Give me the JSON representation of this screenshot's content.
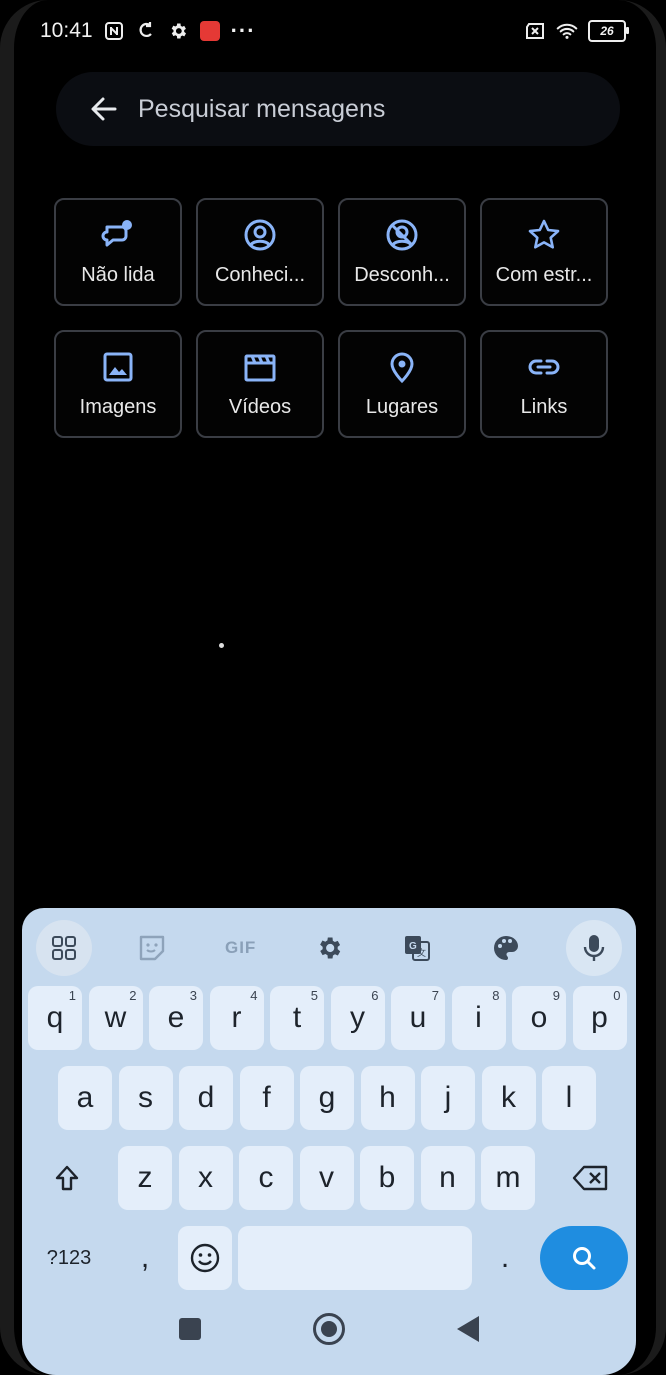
{
  "status_bar": {
    "time": "10:41",
    "more": "···",
    "battery": "26"
  },
  "search": {
    "placeholder": "Pesquisar mensagens"
  },
  "filters": {
    "row1": [
      {
        "label": "Não lida",
        "icon": "unread-chat-icon"
      },
      {
        "label": "Conheci...",
        "icon": "account-circle-icon"
      },
      {
        "label": "Desconh...",
        "icon": "unknown-account-icon"
      },
      {
        "label": "Com estr...",
        "icon": "star-icon"
      }
    ],
    "row2": [
      {
        "label": "Imagens",
        "icon": "image-icon"
      },
      {
        "label": "Vídeos",
        "icon": "video-clapper-icon"
      },
      {
        "label": "Lugares",
        "icon": "location-pin-icon"
      },
      {
        "label": "Links",
        "icon": "link-icon"
      }
    ]
  },
  "keyboard": {
    "toolbar": {
      "gif": "GIF"
    },
    "row1": [
      {
        "k": "q",
        "h": "1"
      },
      {
        "k": "w",
        "h": "2"
      },
      {
        "k": "e",
        "h": "3"
      },
      {
        "k": "r",
        "h": "4"
      },
      {
        "k": "t",
        "h": "5"
      },
      {
        "k": "y",
        "h": "6"
      },
      {
        "k": "u",
        "h": "7"
      },
      {
        "k": "i",
        "h": "8"
      },
      {
        "k": "o",
        "h": "9"
      },
      {
        "k": "p",
        "h": "0"
      }
    ],
    "row2": [
      "a",
      "s",
      "d",
      "f",
      "g",
      "h",
      "j",
      "k",
      "l"
    ],
    "row3": [
      "z",
      "x",
      "c",
      "v",
      "b",
      "n",
      "m"
    ],
    "symbols_label": "?123",
    "comma": ",",
    "period": "."
  },
  "colors": {
    "accent": "#8ab4f8",
    "keyboard_bg": "#c5d9ee",
    "search_key": "#1f8de0"
  }
}
